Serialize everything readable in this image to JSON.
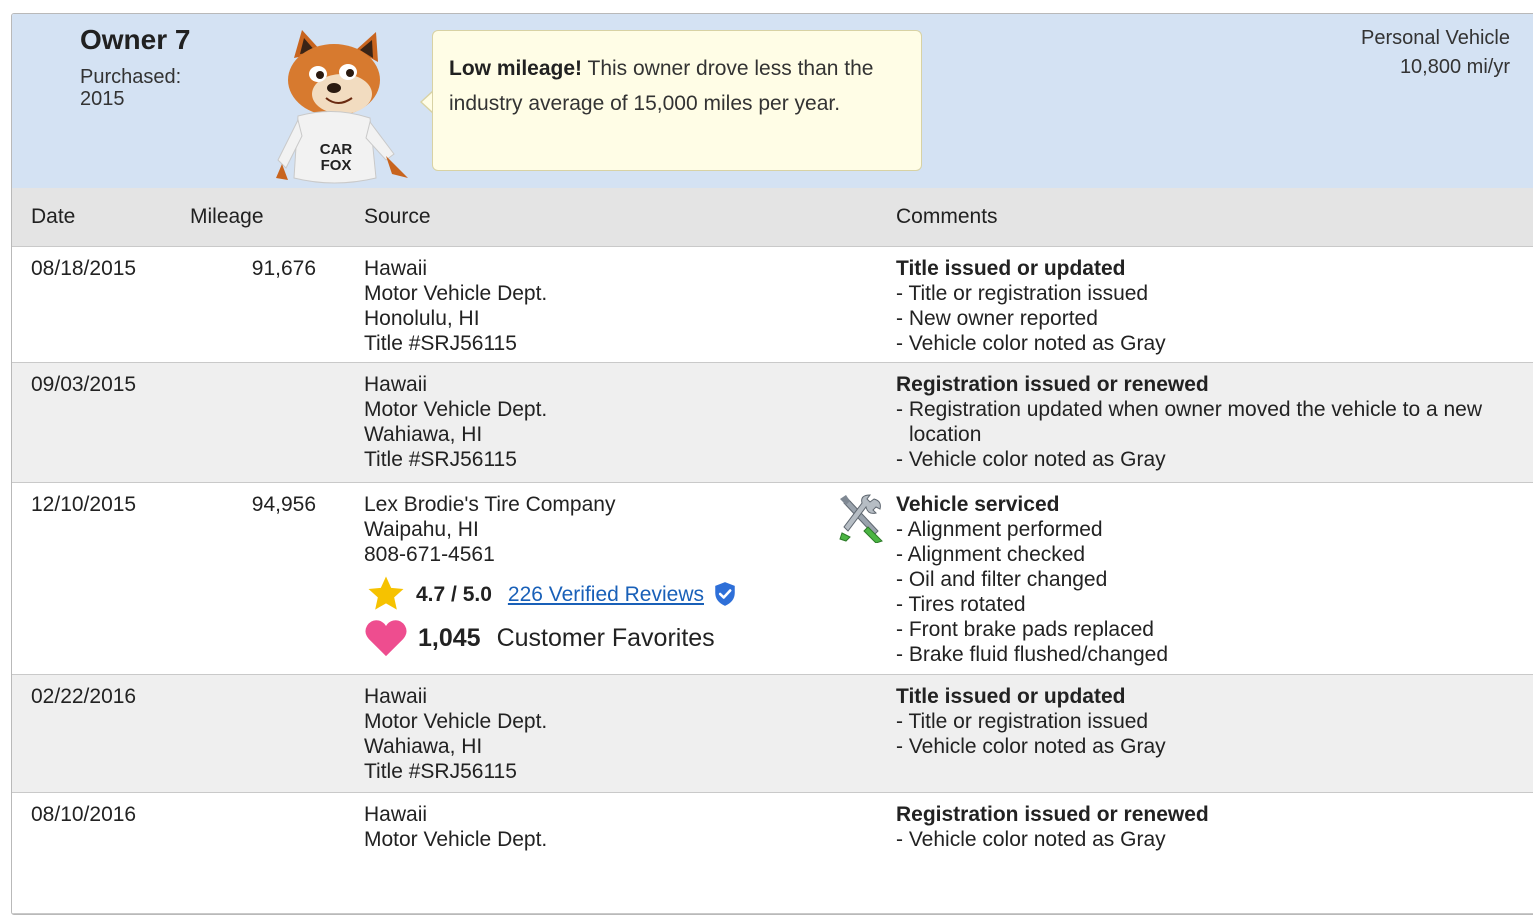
{
  "owner": {
    "title": "Owner 7",
    "purchased_label": "Purchased:",
    "purchased_year": "2015",
    "vehicle_type": "Personal Vehicle",
    "annual_miles": "10,800 mi/yr",
    "tip_bold": "Low mileage!",
    "tip_text": " This owner drove less than the industry average of 15,000 miles per year.",
    "mascot_shirt_text": "CAR FOX"
  },
  "columns": {
    "date": "Date",
    "mileage": "Mileage",
    "source": "Source",
    "comments": "Comments"
  },
  "records": [
    {
      "date": "08/18/2015",
      "mileage": "91,676",
      "source": [
        "Hawaii",
        "Motor Vehicle Dept.",
        "Honolulu, HI",
        "Title #SRJ56115"
      ],
      "comment_head": "Title issued or updated",
      "comments": [
        "Title or registration issued",
        "New owner reported",
        "Vehicle color noted as Gray"
      ]
    },
    {
      "date": "09/03/2015",
      "mileage": "",
      "source": [
        "Hawaii",
        "Motor Vehicle Dept.",
        "Wahiawa, HI",
        "Title #SRJ56115"
      ],
      "comment_head": "Registration issued or renewed",
      "comments": [
        "Registration updated when owner moved the vehicle to a new location",
        "Vehicle color noted as Gray"
      ]
    },
    {
      "date": "12/10/2015",
      "mileage": "94,956",
      "source": [
        "Lex Brodie's Tire Company",
        "Waipahu, HI",
        "808-671-4561"
      ],
      "rating": "4.7 / 5.0",
      "reviews_link": "226 Verified Reviews",
      "favorites_count": "1,045",
      "favorites_label": "Customer Favorites",
      "icon": "service-tools-icon",
      "comment_head": "Vehicle serviced",
      "comments": [
        "Alignment performed",
        "Alignment checked",
        "Oil and filter changed",
        "Tires rotated",
        "Front brake pads replaced",
        "Brake fluid flushed/changed"
      ]
    },
    {
      "date": "02/22/2016",
      "mileage": "",
      "source": [
        "Hawaii",
        "Motor Vehicle Dept.",
        "Wahiawa, HI",
        "Title #SRJ56115"
      ],
      "comment_head": "Title issued or updated",
      "comments": [
        "Title or registration issued",
        "Vehicle color noted as Gray"
      ]
    },
    {
      "date": "08/10/2016",
      "mileage": "",
      "source": [
        "Hawaii",
        "Motor Vehicle Dept."
      ],
      "comment_head": "Registration issued or renewed",
      "comments": [
        "Vehicle color noted as Gray"
      ]
    }
  ],
  "colors": {
    "header_bg": "#d4e2f3",
    "tip_bg": "#fffde6",
    "link": "#1960b8",
    "star": "#f6c200",
    "heart": "#ee4d8f"
  }
}
